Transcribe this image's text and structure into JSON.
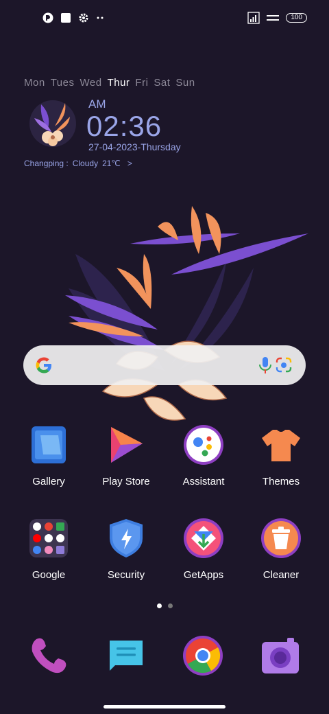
{
  "status_bar": {
    "left_icons": [
      "notification-app-icon",
      "square-icon",
      "gear-icon",
      "more-dots-icon"
    ],
    "signal_icon": "signal-bars-icon",
    "wifi_icon": "data-icon",
    "battery": "100"
  },
  "clock_widget": {
    "days": [
      "Mon",
      "Tues",
      "Wed",
      "Thur",
      "Fri",
      "Sat",
      "Sun"
    ],
    "active_day": "Thur",
    "ampm": "AM",
    "time": "02:36",
    "date": "27-04-2023-Thursday",
    "weather": {
      "city": "Changping :",
      "condition": "Cloudy",
      "temp": "21℃",
      "arrow": ">"
    }
  },
  "search": {
    "icons": [
      "google-g-icon",
      "mic-icon",
      "lens-icon"
    ]
  },
  "apps": [
    {
      "label": "Gallery"
    },
    {
      "label": "Play Store"
    },
    {
      "label": "Assistant"
    },
    {
      "label": "Themes"
    },
    {
      "label": "Google"
    },
    {
      "label": "Security"
    },
    {
      "label": "GetApps"
    },
    {
      "label": "Cleaner"
    }
  ],
  "page_indicator": {
    "pages": 2,
    "current": 1
  },
  "dock": [
    "phone-icon",
    "messages-icon",
    "chrome-icon",
    "camera-icon"
  ],
  "colors": {
    "background": "#1c1629",
    "widget_text": "#9aa5e8",
    "accent_orange": "#f2935c",
    "accent_purple": "#7b4fd0"
  }
}
